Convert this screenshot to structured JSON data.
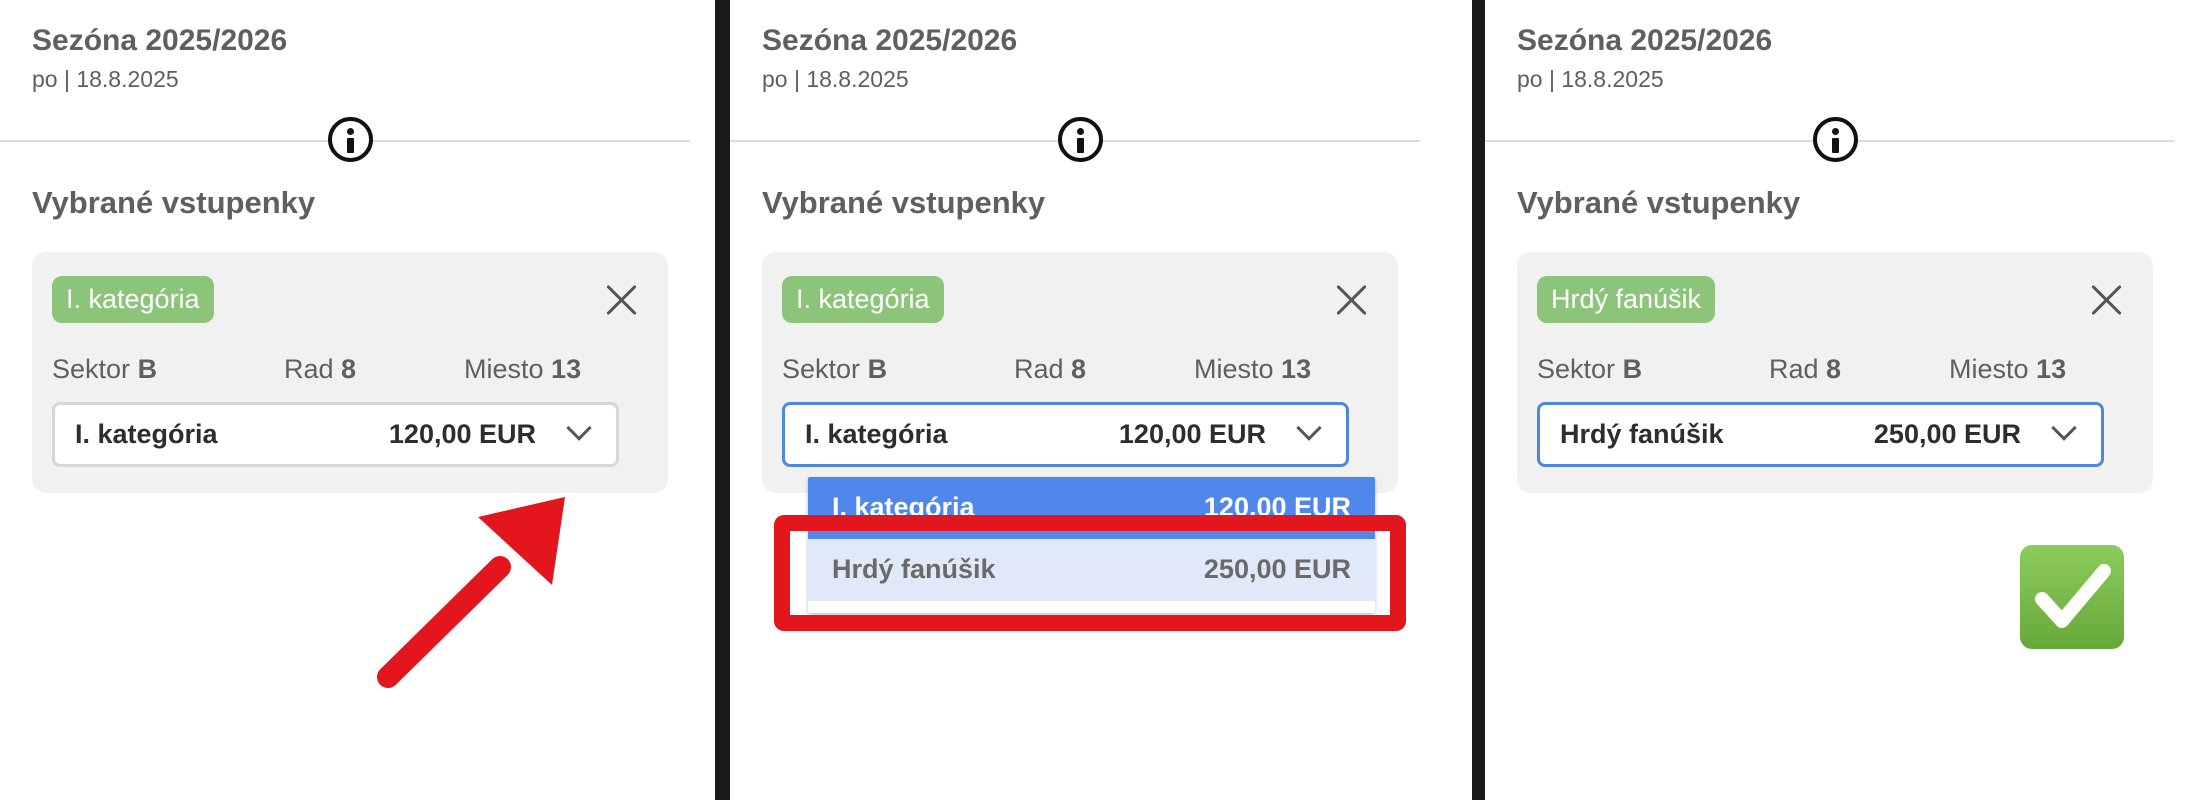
{
  "panels": [
    {
      "season_title": "Sezóna 2025/2026",
      "season_date": "po | 18.8.2025",
      "section_title": "Vybrané vstupenky",
      "badge": "I. kategória",
      "sector_label": "Sektor",
      "sector_value": "B",
      "row_label": "Rad",
      "row_value": "8",
      "place_label": "Miesto",
      "place_value": "13",
      "select_name": "I. kategória",
      "select_price": "120,00 EUR"
    },
    {
      "season_title": "Sezóna 2025/2026",
      "season_date": "po | 18.8.2025",
      "section_title": "Vybrané vstupenky",
      "badge": "I. kategória",
      "sector_label": "Sektor",
      "sector_value": "B",
      "row_label": "Rad",
      "row_value": "8",
      "place_label": "Miesto",
      "place_value": "13",
      "select_name": "I. kategória",
      "select_price": "120,00 EUR",
      "dropdown_options": [
        {
          "name": "I. kategória",
          "price": "120,00 EUR",
          "state": "selected"
        },
        {
          "name": "Hrdý fanúšik",
          "price": "250,00 EUR",
          "state": "hover"
        }
      ]
    },
    {
      "season_title": "Sezóna 2025/2026",
      "season_date": "po | 18.8.2025",
      "section_title": "Vybrané vstupenky",
      "badge": "Hrdý fanúšik",
      "sector_label": "Sektor",
      "sector_value": "B",
      "row_label": "Rad",
      "row_value": "8",
      "place_label": "Miesto",
      "place_value": "13",
      "select_name": "Hrdý fanúšik",
      "select_price": "250,00 EUR"
    }
  ],
  "annotations": {
    "arrow_icon": "red-arrow-icon",
    "highlight_icon": "red-highlight-box",
    "done_icon": "check-mark-icon"
  },
  "colors": {
    "badge": "#8cc57a",
    "focus_border": "#4d87e0",
    "option_selected": "#4f87eb",
    "option_hover": "#dfe9f8",
    "annotation_red": "#e2161c",
    "check_green": "#77b84a",
    "panel_separator": "#1a1a1a"
  }
}
